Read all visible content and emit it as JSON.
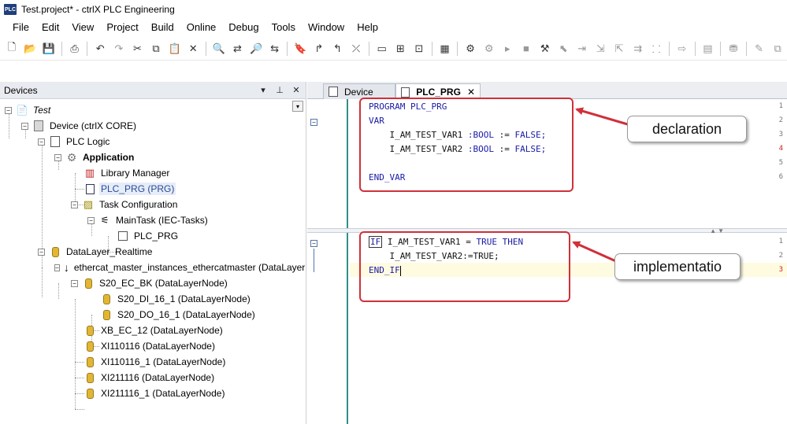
{
  "window": {
    "title": "Test.project* - ctrlX PLC Engineering",
    "app_icon_text": "PLC"
  },
  "menu": [
    "File",
    "Edit",
    "View",
    "Project",
    "Build",
    "Online",
    "Debug",
    "Tools",
    "Window",
    "Help"
  ],
  "devices_panel": {
    "title": "Devices",
    "header_buttons": [
      "▾",
      "⊥",
      "✕"
    ],
    "tree": {
      "root": "Test",
      "device": "Device (ctrlX CORE)",
      "plc_logic": "PLC Logic",
      "application": "Application",
      "library_manager": "Library Manager",
      "plc_prg": "PLC_PRG (PRG)",
      "task_configuration": "Task Configuration",
      "main_task": "MainTask (IEC-Tasks)",
      "main_task_prg": "PLC_PRG",
      "datalayer": "DataLayer_Realtime",
      "ethercat": "ethercat_master_instances_ethercatmaster (DataLayer",
      "s20_ec_bk": "S20_EC_BK (DataLayerNode)",
      "s20_di": "S20_DI_16_1 (DataLayerNode)",
      "s20_do": "S20_DO_16_1 (DataLayerNode)",
      "xb_ec": "XB_EC_12 (DataLayerNode)",
      "xi110116": "XI110116 (DataLayerNode)",
      "xi110116_1": "XI110116_1 (DataLayerNode)",
      "xi211116": "XI211116 (DataLayerNode)",
      "xi211116_1": "XI211116_1 (DataLayerNode)"
    }
  },
  "editor": {
    "tabs": [
      {
        "label": "Device"
      },
      {
        "label": "PLC_PRG"
      }
    ],
    "declaration": {
      "line_numbers": [
        "1",
        "2",
        "3",
        "4",
        "5",
        "6"
      ],
      "line1": "PROGRAM PLC_PRG",
      "line2": "VAR",
      "line3_name": "I_AM_TEST_VAR1",
      "line3_type": ":BOOL",
      "line3_assign": ":=",
      "line3_value": "FALSE;",
      "line4_name": "I_AM_TEST_VAR2",
      "line4_type": ":BOOL",
      "line4_assign": ":=",
      "line4_value": "FALSE;",
      "line6": "END_VAR"
    },
    "implementation": {
      "line_numbers": [
        "1",
        "2",
        "3"
      ],
      "line1_kw": "IF",
      "line1_var": "I_AM_TEST_VAR1",
      "line1_op": "=",
      "line1_true": "TRUE",
      "line1_then": "THEN",
      "line2": "I_AM_TEST_VAR2:=TRUE;",
      "line3": "END_IF"
    }
  },
  "annotations": {
    "declaration": "declaration",
    "implementation": "implementatio"
  },
  "colors": {
    "keyword": "#1a1aa6",
    "annotation_red": "#d0303a",
    "gutter_line": "#2f8f88"
  }
}
